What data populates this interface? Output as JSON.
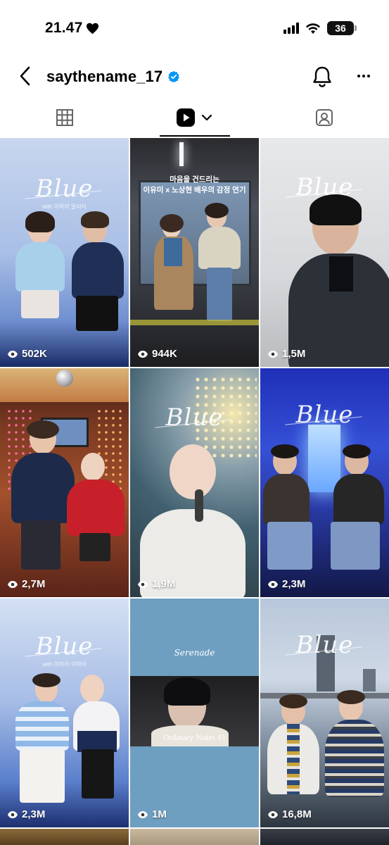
{
  "status": {
    "time": "21.47",
    "battery": "36"
  },
  "header": {
    "username": "saythename_17"
  },
  "tabs": [
    "grid",
    "reels",
    "tagged"
  ],
  "reels": [
    {
      "views": "502K",
      "logo": "Blue",
      "subtitle": "with 이하이 알리어"
    },
    {
      "views": "944K",
      "caption_line1": "마음을 건드리는",
      "caption_line2": "이유미 x 노상현 배우의 감정 연기"
    },
    {
      "views": "1,5M",
      "logo": "Blue"
    },
    {
      "views": "2,7M"
    },
    {
      "views": "1,9M",
      "logo": "Blue"
    },
    {
      "views": "2,3M",
      "logo": "Blue"
    },
    {
      "views": "2,3M",
      "logo": "Blue",
      "subtitle": "with 이하이 이하이"
    },
    {
      "views": "1M",
      "title": "Serenade",
      "footer": "Ordinary Notes #1"
    },
    {
      "views": "16,8M",
      "logo": "Blue"
    }
  ],
  "colors": {
    "accent": "#0095f6",
    "text": "#000000"
  }
}
